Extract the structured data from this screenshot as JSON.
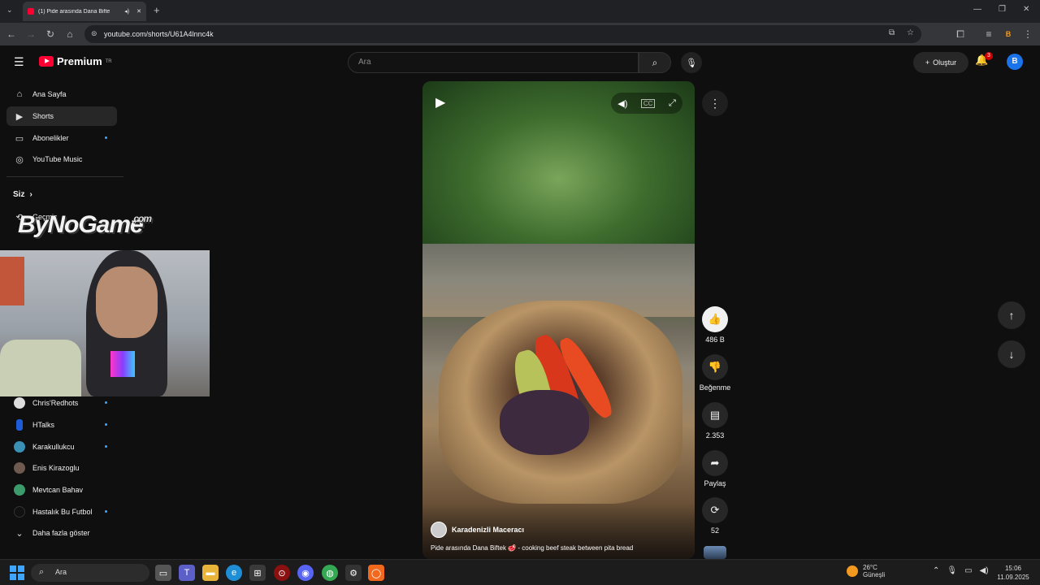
{
  "browser": {
    "tab_title": "(1) Pide arasında Dana Bifte",
    "url": "youtube.com/shorts/U61A4lnnc4k",
    "profile_initial": "B"
  },
  "header": {
    "logo": "Premium",
    "logo_sup": "TR",
    "search_placeholder": "Ara",
    "create_label": "Oluştur",
    "notifications": "3",
    "avatar_initial": "B"
  },
  "sidebar": {
    "main": [
      {
        "label": "Ana Sayfa",
        "icon": "home-icon"
      },
      {
        "label": "Shorts",
        "icon": "shorts-icon"
      },
      {
        "label": "Abonelikler",
        "icon": "subscriptions-icon"
      },
      {
        "label": "YouTube Music",
        "icon": "music-icon"
      }
    ],
    "you_label": "Siz",
    "history_label": "Geçmiş",
    "channels": [
      {
        "label": "Chris'Redhots"
      },
      {
        "label": "HTalks"
      },
      {
        "label": "Karakullukcu"
      },
      {
        "label": "Enis Kirazoglu"
      },
      {
        "label": "Mevtcan Bahav"
      },
      {
        "label": "Hastalık Bu Futbol"
      }
    ],
    "show_more": "Daha fazla göster"
  },
  "overlay": {
    "watermark": "ByNoGame",
    "watermark_suffix": ".com"
  },
  "video": {
    "channel": "Karadenizli Maceracı",
    "title": "Pide arasında Dana Biftek 🥩 - cooking beef steak between pita bread",
    "likes": "486 B",
    "dislike_label": "Beğenme",
    "comments": "2.353",
    "share_label": "Paylaş",
    "remix_count": "52"
  },
  "taskbar": {
    "search_label": "Ara",
    "weather_temp": "26°C",
    "weather_desc": "Güneşli",
    "time": "15:06",
    "date": "11.09.2025"
  }
}
